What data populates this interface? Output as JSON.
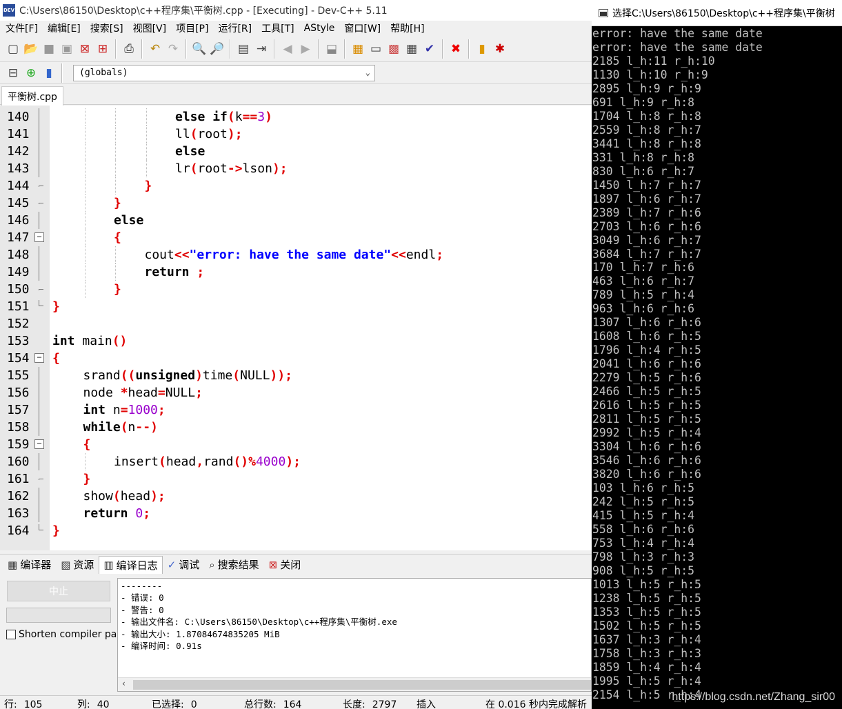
{
  "window": {
    "title": "C:\\Users\\86150\\Desktop\\c++程序集\\平衡树.cpp - [Executing] - Dev-C++ 5.11",
    "icon_label": "DEV"
  },
  "menu": [
    {
      "label": "文件[F]"
    },
    {
      "label": "编辑[E]"
    },
    {
      "label": "搜索[S]"
    },
    {
      "label": "视图[V]"
    },
    {
      "label": "项目[P]"
    },
    {
      "label": "运行[R]"
    },
    {
      "label": "工具[T]"
    },
    {
      "label": "AStyle"
    },
    {
      "label": "窗口[W]"
    },
    {
      "label": "帮助[H]"
    }
  ],
  "scope": {
    "value": "(globals)"
  },
  "editor_tab": {
    "label": "平衡树.cpp"
  },
  "code_lines": [
    {
      "num": "140",
      "fold": "line",
      "text": "else if(k==3)"
    },
    {
      "num": "141",
      "fold": "line",
      "text": "ll(root);"
    },
    {
      "num": "142",
      "fold": "line",
      "text": "else"
    },
    {
      "num": "143",
      "fold": "line",
      "text": "lr(root->lson);"
    },
    {
      "num": "144",
      "fold": "tick",
      "text": "}"
    },
    {
      "num": "145",
      "fold": "tick",
      "text": "}"
    },
    {
      "num": "146",
      "fold": "line",
      "text": "else"
    },
    {
      "num": "147",
      "fold": "box",
      "text": "{"
    },
    {
      "num": "148",
      "fold": "line",
      "text": "cout<<\"error: have the same date\"<<endl;"
    },
    {
      "num": "149",
      "fold": "line",
      "text": "return ;"
    },
    {
      "num": "150",
      "fold": "tick",
      "text": "}"
    },
    {
      "num": "151",
      "fold": "end",
      "text": "}"
    },
    {
      "num": "152",
      "fold": "none",
      "text": ""
    },
    {
      "num": "153",
      "fold": "none",
      "text": "int main()"
    },
    {
      "num": "154",
      "fold": "box",
      "text": "{"
    },
    {
      "num": "155",
      "fold": "line",
      "text": "srand((unsigned)time(NULL));"
    },
    {
      "num": "156",
      "fold": "line",
      "text": "node *head=NULL;"
    },
    {
      "num": "157",
      "fold": "line",
      "text": "int n=1000;"
    },
    {
      "num": "158",
      "fold": "line",
      "text": "while(n--)"
    },
    {
      "num": "159",
      "fold": "box",
      "text": "{"
    },
    {
      "num": "160",
      "fold": "line",
      "text": "insert(head,rand()%4000);"
    },
    {
      "num": "161",
      "fold": "tick",
      "text": "}"
    },
    {
      "num": "162",
      "fold": "line",
      "text": "show(head);"
    },
    {
      "num": "163",
      "fold": "line",
      "text": "return 0;"
    },
    {
      "num": "164",
      "fold": "end",
      "text": "}"
    }
  ],
  "bottom_tabs": [
    {
      "label": "编译器",
      "icon": "grid-icon"
    },
    {
      "label": "资源",
      "icon": "resources-icon"
    },
    {
      "label": "编译日志",
      "icon": "bar-chart-icon",
      "active": true
    },
    {
      "label": "调试",
      "icon": "check-icon"
    },
    {
      "label": "搜索结果",
      "icon": "search-icon"
    },
    {
      "label": "关闭",
      "icon": "close-icon"
    }
  ],
  "compile_panel": {
    "stop_label": "中止",
    "shorten_label": "Shorten compiler pa"
  },
  "compile_log": [
    "--------",
    "- 错误: 0",
    "- 警告: 0",
    "- 输出文件名: C:\\Users\\86150\\Desktop\\c++程序集\\平衡树.exe",
    "- 输出大小: 1.87084674835205 MiB",
    "- 编译时间: 0.91s"
  ],
  "status": {
    "row_label": "行:",
    "row": "105",
    "col_label": "列:",
    "col": "40",
    "sel_label": "已选择:",
    "sel": "0",
    "lines_label": "总行数:",
    "lines": "164",
    "len_label": "长度:",
    "len": "2797",
    "mode": "插入",
    "parse": "在 0.016 秒内完成解析"
  },
  "console": {
    "title": "选择C:\\Users\\86150\\Desktop\\c++程序集\\平衡树",
    "lines": [
      "error: have the same date",
      "error: have the same date",
      "2185 l_h:11 r_h:10",
      "1130 l_h:10 r_h:9",
      "2895 l_h:9 r_h:9",
      "691 l_h:9 r_h:8",
      "1704 l_h:8 r_h:8",
      "2559 l_h:8 r_h:7",
      "3441 l_h:8 r_h:8",
      "331 l_h:8 r_h:8",
      "830 l_h:6 r_h:7",
      "1450 l_h:7 r_h:7",
      "1897 l_h:6 r_h:7",
      "2389 l_h:7 r_h:6",
      "2703 l_h:6 r_h:6",
      "3049 l_h:6 r_h:7",
      "3684 l_h:7 r_h:7",
      "170 l_h:7 r_h:6",
      "463 l_h:6 r_h:7",
      "789 l_h:5 r_h:4",
      "963 l_h:6 r_h:6",
      "1307 l_h:6 r_h:6",
      "1608 l_h:6 r_h:5",
      "1796 l_h:4 r_h:5",
      "2041 l_h:6 r_h:6",
      "2279 l_h:5 r_h:6",
      "2466 l_h:5 r_h:5",
      "2616 l_h:5 r_h:5",
      "2811 l_h:5 r_h:5",
      "2992 l_h:5 r_h:4",
      "3304 l_h:6 r_h:6",
      "3546 l_h:6 r_h:6",
      "3820 l_h:6 r_h:6",
      "103 l_h:6 r_h:5",
      "242 l_h:5 r_h:5",
      "415 l_h:5 r_h:4",
      "558 l_h:6 r_h:6",
      "753 l_h:4 r_h:4",
      "798 l_h:3 r_h:3",
      "908 l_h:5 r_h:5",
      "1013 l_h:5 r_h:5",
      "1238 l_h:5 r_h:5",
      "1353 l_h:5 r_h:5",
      "1502 l_h:5 r_h:5",
      "1637 l_h:3 r_h:4",
      "1758 l_h:3 r_h:3",
      "1859 l_h:4 r_h:4",
      "1995 l_h:5 r_h:4",
      "2154 l_h:5 r_h:4"
    ]
  },
  "watermark": "https://blog.csdn.net/Zhang_sir00"
}
